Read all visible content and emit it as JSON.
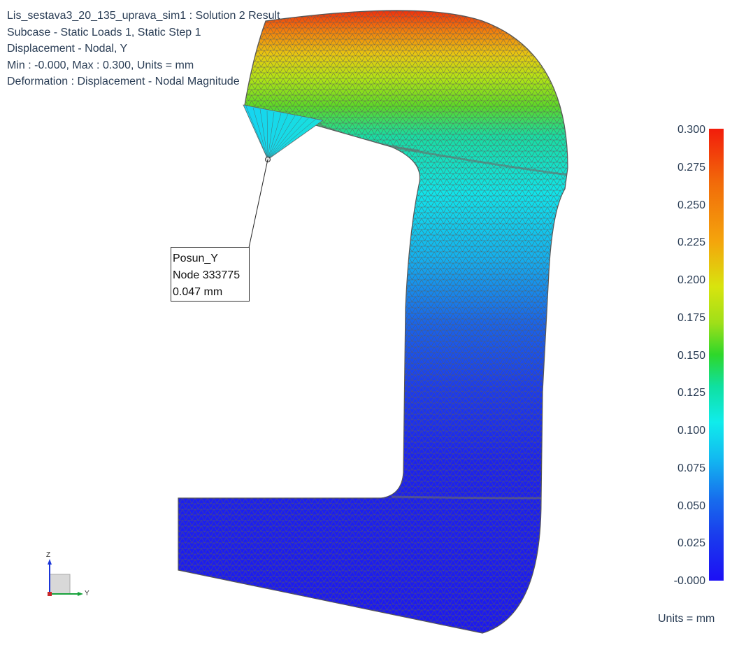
{
  "header": {
    "line1": "Lis_sestava3_20_135_uprava_sim1 : Solution 2 Result",
    "line2": "Subcase - Static Loads 1, Static Step 1",
    "line3": "Displacement - Nodal, Y",
    "line4": "Min : -0.000, Max : 0.300, Units = mm",
    "line5": "Deformation : Displacement - Nodal Magnitude"
  },
  "probe": {
    "name": "Posun_Y",
    "node": "Node 333775",
    "value": "0.047 mm"
  },
  "legend": {
    "values": [
      "0.300",
      "0.275",
      "0.250",
      "0.225",
      "0.200",
      "0.175",
      "0.150",
      "0.125",
      "0.100",
      "0.075",
      "0.050",
      "0.025",
      "-0.000"
    ],
    "units": "Units = mm",
    "min": -0.0,
    "max": 0.3,
    "colors": {
      "max": "#f21c0b",
      "mid": "#2ed72a",
      "low": "#10ecec",
      "min": "#1c0ff5"
    }
  },
  "triad": {
    "z": "Z",
    "y": "Y"
  },
  "colors": {
    "text": "#2a3d55",
    "mesh_line": "#5a5a5a",
    "background": "#ffffff"
  }
}
